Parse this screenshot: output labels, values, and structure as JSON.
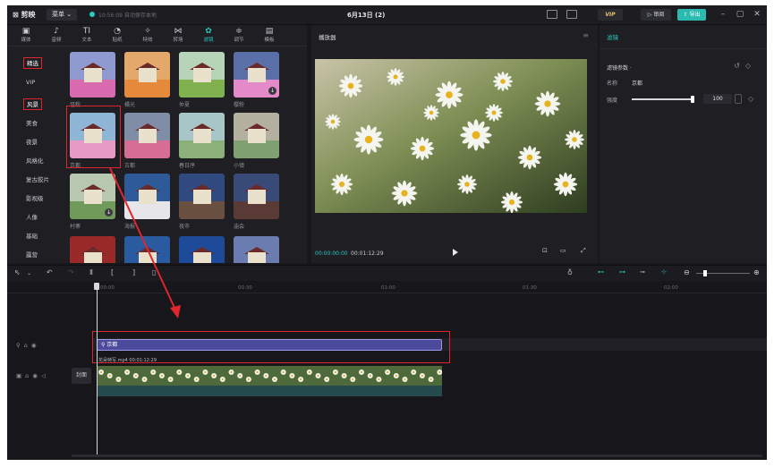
{
  "titlebar": {
    "logo": "剪映",
    "menu": "菜单 ⌄",
    "save_status": "10:56:09 自动保存本地",
    "doc_title": "6月13日 (2)",
    "vip": "VIP",
    "review": "审阅",
    "export": "导出",
    "win": [
      "–",
      "▢",
      "✕"
    ]
  },
  "tabs": [
    {
      "icon": "▣",
      "label": "媒体"
    },
    {
      "icon": "♪",
      "label": "音频"
    },
    {
      "icon": "TI",
      "label": "文本"
    },
    {
      "icon": "◔",
      "label": "贴纸"
    },
    {
      "icon": "✧",
      "label": "特效"
    },
    {
      "icon": "⋈",
      "label": "转场"
    },
    {
      "icon": "✿",
      "label": "滤镜"
    },
    {
      "icon": "≑",
      "label": "调节"
    },
    {
      "icon": "▤",
      "label": "模板"
    }
  ],
  "categories": [
    "精选",
    "VIP",
    "风景",
    "美食",
    "夜景",
    "风格化",
    "复古胶片",
    "影视级",
    "人像",
    "基础",
    "露营"
  ],
  "filters": [
    {
      "label": "怪粉",
      "sky": "#8f9ad0",
      "ground": "#d86ab0",
      "dl": false
    },
    {
      "label": "橘光",
      "sky": "#e4a86a",
      "ground": "#e58a3a",
      "dl": false
    },
    {
      "label": "仲夏",
      "sky": "#b8d4b8",
      "ground": "#7fb24f",
      "dl": false
    },
    {
      "label": "樱粉",
      "sky": "#5a6fa8",
      "ground": "#e48ac8",
      "dl": true
    },
    {
      "label": "京都",
      "sky": "#8fb6d6",
      "ground": "#e79ac6",
      "dl": false
    },
    {
      "label": "古都",
      "sky": "#7f8ea6",
      "ground": "#d66d95",
      "dl": false
    },
    {
      "label": "春日序",
      "sky": "#a6c6c8",
      "ground": "#8bb07a",
      "dl": false
    },
    {
      "label": "小镇",
      "sky": "#b4b0a0",
      "ground": "#7fa070",
      "dl": false
    },
    {
      "label": "村寨",
      "sky": "#b8c8b0",
      "ground": "#6f9a5a",
      "dl": true
    },
    {
      "label": "海报",
      "sky": "#2f5a9a",
      "ground": "#e6e6ea",
      "dl": false
    },
    {
      "label": "夜市",
      "sky": "#304a80",
      "ground": "#6a5040",
      "dl": false
    },
    {
      "label": "庙会",
      "sky": "#3a4a78",
      "ground": "#5a3a34",
      "dl": false
    },
    {
      "label": "",
      "sky": "#9a2a2a",
      "ground": "#c04030",
      "dl": false
    },
    {
      "label": "",
      "sky": "#2a5aa0",
      "ground": "#e6e6ee",
      "dl": false
    },
    {
      "label": "",
      "sky": "#1e4a9a",
      "ground": "#d04030",
      "dl": false
    },
    {
      "label": "",
      "sky": "#6a7cb0",
      "ground": "#8090c0",
      "dl": false
    }
  ],
  "player": {
    "title": "播放器",
    "time_current": "00:00:00:00",
    "time_total": "00:01:12:29"
  },
  "props": {
    "tab": "滤镜",
    "section": "滤镜参数 ·",
    "name_label": "名称",
    "name_value": "京都",
    "strength_label": "强度",
    "strength_value": "100",
    "strength_level": 1.0
  },
  "timeline": {
    "ruler": [
      "00:00",
      "00:30",
      "01:00",
      "01:30",
      "02:00"
    ],
    "filter_clip": "⚲ 京都",
    "video_header": "花朵特写.mp4  00:01:12:29",
    "cover": "封面"
  },
  "colors": {
    "accent": "#2ec6c2",
    "highlight": "#e0262d",
    "filter_clip": "#4c4a9a"
  }
}
